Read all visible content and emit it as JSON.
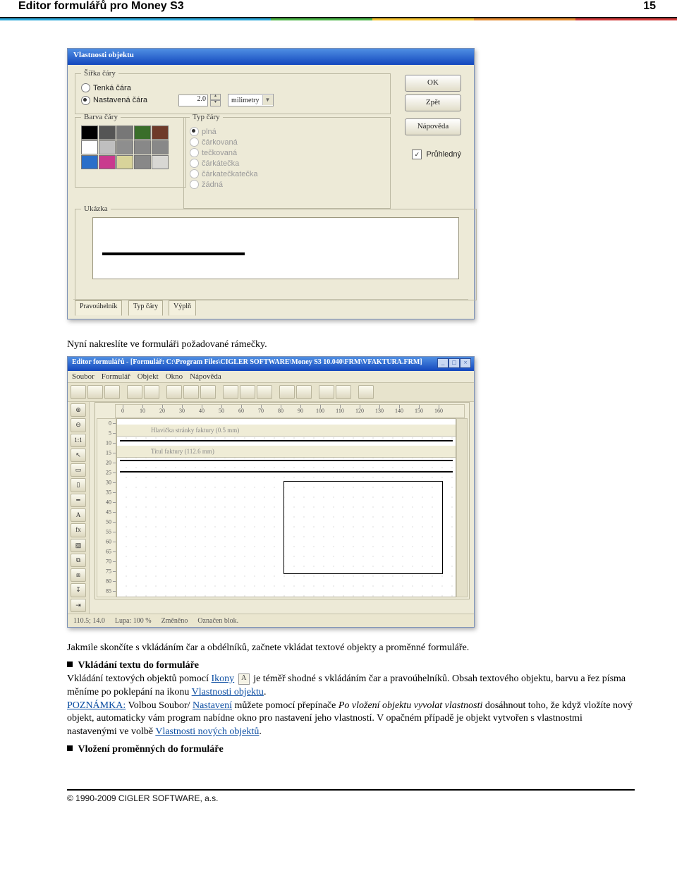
{
  "header": {
    "title": "Editor formulářů pro Money S3",
    "page": "15"
  },
  "dialog1": {
    "title": "Vlastnosti objektu",
    "grp_width": "Šířka čáry",
    "rad_thin": "Tenká čára",
    "rad_set": "Nastavená čára",
    "width_val": "2.0",
    "width_unit": "milimetry",
    "grp_color": "Barva čáry",
    "grp_type": "Typ čáry",
    "type_opts": [
      "plná",
      "čárkovaná",
      "tečkovaná",
      "čárkátečka",
      "čárkatečkatečka",
      "žádná"
    ],
    "grp_sample": "Ukázka",
    "btn_ok": "OK",
    "btn_back": "Zpět",
    "btn_help": "Nápověda",
    "chk_transparent": "Průhledný",
    "tab1": "Pravoúhelník",
    "tab2": "Typ čáry",
    "tab3": "Výplň",
    "colors": [
      "#000000",
      "#555555",
      "#777777",
      "#3a6e2a",
      "#6e3a2a",
      "#ffffff",
      "#bfbfbf",
      "#8e8e8e",
      "#888888",
      "#888888",
      "#2a6fc9",
      "#c93a8e",
      "#d8d39a",
      "#888888",
      "#d8d7d3"
    ]
  },
  "p_after_dlg1": "Nyní nakreslíte ve formuláři požadované rámečky.",
  "dialog2": {
    "title": "Editor formulářů - [Formulář: C:\\Program Files\\CIGLER SOFTWARE\\Money S3 10.040\\FRM\\VFAKTURA.FRM]",
    "menus": [
      "Soubor",
      "Formulář",
      "Objekt",
      "Okno",
      "Nápověda"
    ],
    "ruler_ticks": [
      "0",
      "10",
      "20",
      "30",
      "40",
      "50",
      "60",
      "70",
      "80",
      "90",
      "100",
      "110",
      "120",
      "130",
      "140",
      "150",
      "160"
    ],
    "ruler_v_ticks": [
      "0",
      "5",
      "10",
      "15",
      "20",
      "25",
      "30",
      "35",
      "40",
      "45",
      "50",
      "55",
      "60",
      "65",
      "70",
      "75",
      "80",
      "85"
    ],
    "section1": "Hlavička stránky faktury (0.5 mm)",
    "section2": "Titul faktury (112.6 mm)",
    "status_coords": "110.5; 14.0",
    "status_zoom": "Lupa: 100 %",
    "status_changed": "Změněno",
    "status_block": "Označen blok."
  },
  "body": {
    "p1": "Jakmile skončíte s vkládáním čar a obdélníků, začnete vkládat textové objekty a proměnné formuláře.",
    "h1": "Vkládání textu do formuláře",
    "p2a": "Vkládání textových objektů pomocí ",
    "link_ikony": "Ikony",
    "p2b": " je téměř shodné s vkládáním čar a pravoúhelníků. Obsah textového objektu, barvu a řez písma měníme po poklepání na ikonu ",
    "link_vlast": "Vlastnosti objektu",
    "p2c": ".",
    "note_label": "POZNÁMKA:",
    "p3a": " Volbou Soubor/",
    "link_nast": "Nastavení",
    "p3b": " můžete pomocí přepínače ",
    "ital": "Po vložení objektu vyvolat vlastnosti",
    "p3c": " dosáhnout toho, že když vložíte nový objekt, automaticky vám program nabídne okno pro nastavení jeho vlastností. V opačném případě je objekt vytvořen s vlastnostmi nastavenými ve volbě ",
    "link_vno": "Vlastnosti nových objektů",
    "p3d": ".",
    "h2": "Vložení proměnných do formuláře"
  },
  "footer": "© 1990-2009 CIGLER SOFTWARE, a.s."
}
